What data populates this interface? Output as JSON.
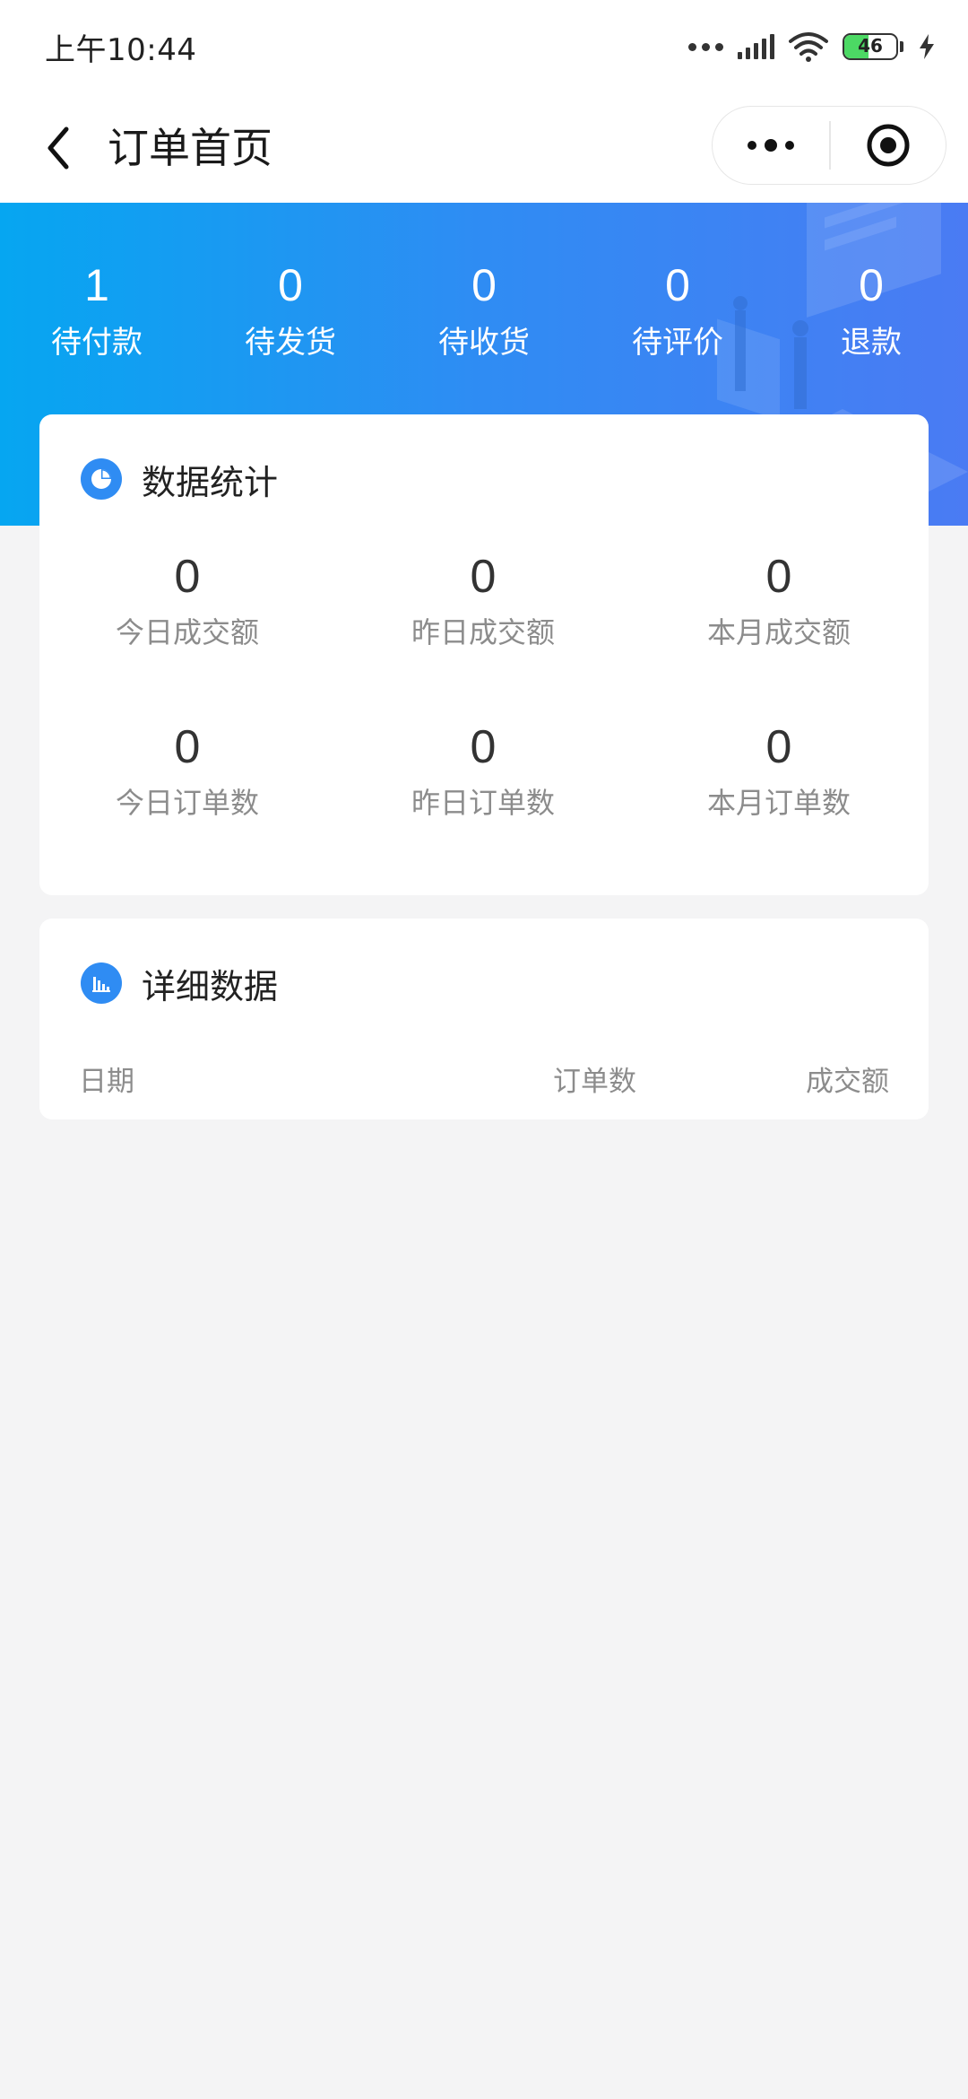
{
  "status_bar": {
    "time": "上午10:44",
    "battery_level": "46",
    "battery_fraction": 0.46
  },
  "nav": {
    "title": "订单首页",
    "back_icon": "chevron-left-icon",
    "more_icon": "more-dots-icon",
    "close_icon": "target-circle-icon"
  },
  "order_status": [
    {
      "count": "1",
      "label": "待付款"
    },
    {
      "count": "0",
      "label": "待发货"
    },
    {
      "count": "0",
      "label": "待收货"
    },
    {
      "count": "0",
      "label": "待评价"
    },
    {
      "count": "0",
      "label": "退款"
    }
  ],
  "stats_card": {
    "title": "数据统计",
    "icon": "pie-chart-icon",
    "rows": [
      [
        {
          "value": "0",
          "label": "今日成交额"
        },
        {
          "value": "0",
          "label": "昨日成交额"
        },
        {
          "value": "0",
          "label": "本月成交额"
        }
      ],
      [
        {
          "value": "0",
          "label": "今日订单数"
        },
        {
          "value": "0",
          "label": "昨日订单数"
        },
        {
          "value": "0",
          "label": "本月订单数"
        }
      ]
    ]
  },
  "detail_card": {
    "title": "详细数据",
    "icon": "bar-chart-icon",
    "columns": [
      "日期",
      "订单数",
      "成交额"
    ]
  },
  "colors": {
    "accent": "#2f8cf3",
    "banner_start": "#06a6f1",
    "banner_end": "#4a7bf3",
    "background": "#f4f4f5",
    "muted_text": "#8c8c8c"
  }
}
